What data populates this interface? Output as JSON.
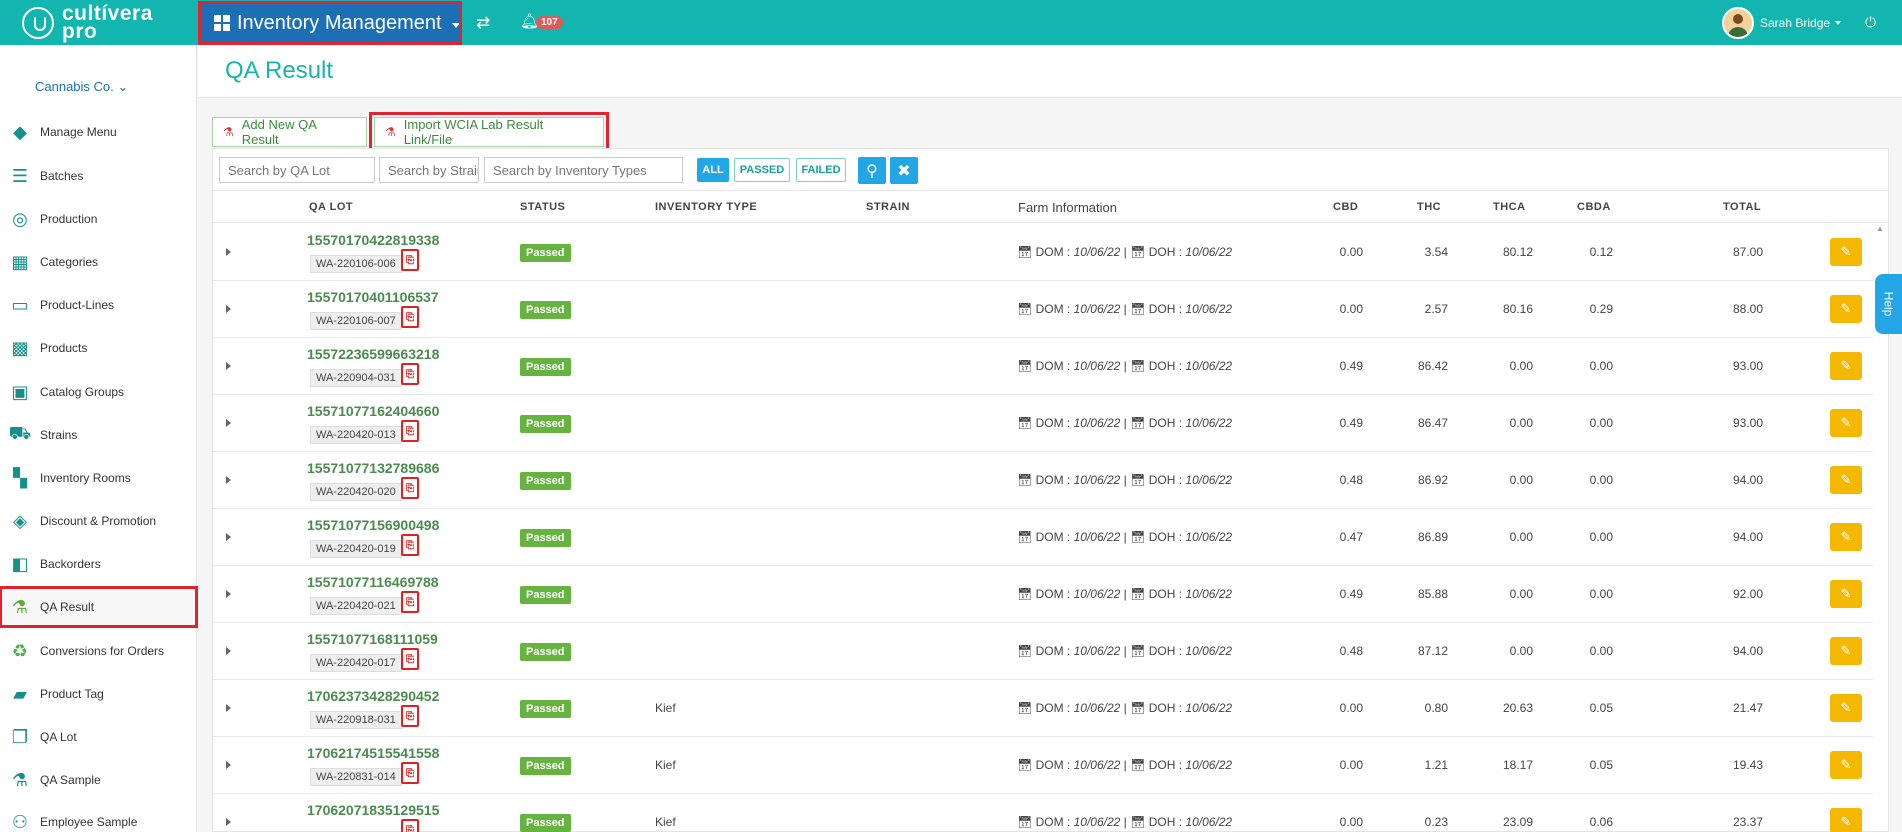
{
  "app": {
    "logo_line1": "cultívera",
    "logo_line2": "pro"
  },
  "topbar": {
    "module": "Inventory Management",
    "notifications": "107",
    "user_name": "Sarah Bridge"
  },
  "sidebar": {
    "company": "Cannabis Co.",
    "items": [
      {
        "label": "Manage Menu",
        "icon": "book-icon"
      },
      {
        "label": "Batches",
        "icon": "list-icon"
      },
      {
        "label": "Production",
        "icon": "production-icon"
      },
      {
        "label": "Categories",
        "icon": "table-icon"
      },
      {
        "label": "Product-Lines",
        "icon": "product-lines-icon"
      },
      {
        "label": "Products",
        "icon": "grid-icon"
      },
      {
        "label": "Catalog Groups",
        "icon": "catalog-icon"
      },
      {
        "label": "Strains",
        "icon": "strains-icon"
      },
      {
        "label": "Inventory Rooms",
        "icon": "rooms-icon"
      },
      {
        "label": "Discount & Promotion",
        "icon": "tags-icon"
      },
      {
        "label": "Backorders",
        "icon": "backorders-icon"
      },
      {
        "label": "QA Result",
        "icon": "flask-icon"
      },
      {
        "label": "Conversions for Orders",
        "icon": "recycle-icon"
      },
      {
        "label": "Product Tag",
        "icon": "tag-icon"
      },
      {
        "label": "QA Lot",
        "icon": "qa-lot-icon"
      },
      {
        "label": "QA Sample",
        "icon": "qa-sample-icon"
      },
      {
        "label": "Employee Sample",
        "icon": "employee-sample-icon"
      }
    ]
  },
  "page": {
    "title": "QA Result",
    "add_button": "Add New QA Result",
    "import_button": "Import WCIA Lab Result Link/File"
  },
  "filters": {
    "qa_lot_placeholder": "Search by QA Lot",
    "strain_placeholder": "Search by Strain",
    "inventory_placeholder": "Search by Inventory Types",
    "all": "ALL",
    "passed": "PASSED",
    "failed": "FAILED"
  },
  "columns": {
    "qa_lot": "QA LOT",
    "status": "STATUS",
    "inventory_type": "INVENTORY TYPE",
    "strain": "STRAIN",
    "farm": "Farm Information",
    "cbd": "CBD",
    "thc": "THC",
    "thca": "THCA",
    "cbda": "CBDA",
    "total": "TOTAL"
  },
  "rows": [
    {
      "lot": "15570170422819338",
      "wa": "WA-220106-006",
      "status": "Passed",
      "inv": "",
      "dom": "10/06/22",
      "doh": "10/06/22",
      "cbd": "0.00",
      "thc": "3.54",
      "thca": "80.12",
      "cbda": "0.12",
      "total": "87.00"
    },
    {
      "lot": "15570170401106537",
      "wa": "WA-220106-007",
      "status": "Passed",
      "inv": "",
      "dom": "10/06/22",
      "doh": "10/06/22",
      "cbd": "0.00",
      "thc": "2.57",
      "thca": "80.16",
      "cbda": "0.29",
      "total": "88.00"
    },
    {
      "lot": "15572236599663218",
      "wa": "WA-220904-031",
      "status": "Passed",
      "inv": "",
      "dom": "10/06/22",
      "doh": "10/06/22",
      "cbd": "0.49",
      "thc": "86.42",
      "thca": "0.00",
      "cbda": "0.00",
      "total": "93.00"
    },
    {
      "lot": "15571077162404660",
      "wa": "WA-220420-013",
      "status": "Passed",
      "inv": "",
      "dom": "10/06/22",
      "doh": "10/06/22",
      "cbd": "0.49",
      "thc": "86.47",
      "thca": "0.00",
      "cbda": "0.00",
      "total": "93.00"
    },
    {
      "lot": "15571077132789686",
      "wa": "WA-220420-020",
      "status": "Passed",
      "inv": "",
      "dom": "10/06/22",
      "doh": "10/06/22",
      "cbd": "0.48",
      "thc": "86.92",
      "thca": "0.00",
      "cbda": "0.00",
      "total": "94.00"
    },
    {
      "lot": "15571077156900498",
      "wa": "WA-220420-019",
      "status": "Passed",
      "inv": "",
      "dom": "10/06/22",
      "doh": "10/06/22",
      "cbd": "0.47",
      "thc": "86.89",
      "thca": "0.00",
      "cbda": "0.00",
      "total": "94.00"
    },
    {
      "lot": "15571077116469788",
      "wa": "WA-220420-021",
      "status": "Passed",
      "inv": "",
      "dom": "10/06/22",
      "doh": "10/06/22",
      "cbd": "0.49",
      "thc": "85.88",
      "thca": "0.00",
      "cbda": "0.00",
      "total": "92.00"
    },
    {
      "lot": "15571077168111059",
      "wa": "WA-220420-017",
      "status": "Passed",
      "inv": "",
      "dom": "10/06/22",
      "doh": "10/06/22",
      "cbd": "0.48",
      "thc": "87.12",
      "thca": "0.00",
      "cbda": "0.00",
      "total": "94.00"
    },
    {
      "lot": "17062373428290452",
      "wa": "WA-220918-031",
      "status": "Passed",
      "inv": "Kief",
      "dom": "10/06/22",
      "doh": "10/06/22",
      "cbd": "0.00",
      "thc": "0.80",
      "thca": "20.63",
      "cbda": "0.05",
      "total": "21.47"
    },
    {
      "lot": "17062174515541558",
      "wa": "WA-220831-014",
      "status": "Passed",
      "inv": "Kief",
      "dom": "10/06/22",
      "doh": "10/06/22",
      "cbd": "0.00",
      "thc": "1.21",
      "thca": "18.17",
      "cbda": "0.05",
      "total": "19.43"
    },
    {
      "lot": "17062071835129515",
      "wa": "",
      "status": "Passed",
      "inv": "Kief",
      "dom": "10/06/22",
      "doh": "10/06/22",
      "cbd": "0.00",
      "thc": "0.23",
      "thca": "23.09",
      "cbda": "0.06",
      "total": "23.37"
    }
  ],
  "farm_labels": {
    "dom": "DOM :",
    "doh": "DOH :",
    "sep": "|"
  },
  "help": "Help"
}
